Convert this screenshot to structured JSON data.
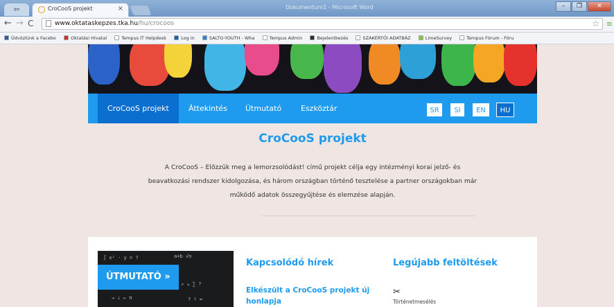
{
  "browser": {
    "tab_title": "CroCooS projekt",
    "tab_close": "×",
    "back_tab_glyph": "⇦",
    "window_title_blurred": "Dokumentum1 - Microsoft Word",
    "window_buttons": [
      "–",
      "❐",
      "✕"
    ],
    "url_host": "www.oktataskepzes.tka.hu",
    "url_path": "/hu/crocoos",
    "nav": {
      "back": "←",
      "forward": "→",
      "reload": "C"
    },
    "star": "☆",
    "menu": "≡"
  },
  "bookmarks": [
    {
      "label": "Üdvözlünk a Facebo",
      "color": "#3b5998"
    },
    {
      "label": "Oktatási Hivatal",
      "color": "#d93025"
    },
    {
      "label": "Tempus IT Helpdesk",
      "color": "#ffffff"
    },
    {
      "label": "Log in",
      "color": "#1f5fa8"
    },
    {
      "label": "SALTO-YOUTH - Wha",
      "color": "#3a7bd5"
    },
    {
      "label": "Tempus Admin",
      "color": "#ffffff"
    },
    {
      "label": "Bejelentkezés",
      "color": "#2b2b2b"
    },
    {
      "label": "SZAKÉRTŐI ADATBÁZ",
      "color": "#ffffff"
    },
    {
      "label": "LimeSurvey",
      "color": "#8fbf3f"
    },
    {
      "label": "Tempus Fórum - Föru",
      "color": "#ffffff"
    }
  ],
  "site": {
    "nav_items": [
      "CroCooS projekt",
      "Áttekintés",
      "Útmutató",
      "Eszköztár"
    ],
    "languages": [
      "SR",
      "SI",
      "EN",
      "HU"
    ],
    "active_language": "HU",
    "title": "CroCooS projekt",
    "intro": "A CroCooS – Előzzük meg a lemorzsolódást! című projekt célja egy intézményi korai jelző- és beavatkozási rendszer kidolgozása, és három országban történő tesztelése a partner országokban már működő adatok összegyűjtése és elemzése alapján.",
    "guide_button": "ÚTMUTATÓ »",
    "news_heading": "Kapcsolódó hírek",
    "news_item": "Elkészült a CroCooS projekt új honlapja",
    "uploads_heading": "Legújabb feltöltések",
    "upload_icon": "✂",
    "upload_item": "Történetmesélés"
  },
  "colors": {
    "brand_blue": "#1e9bef",
    "active_blue": "#0b6fd0"
  }
}
